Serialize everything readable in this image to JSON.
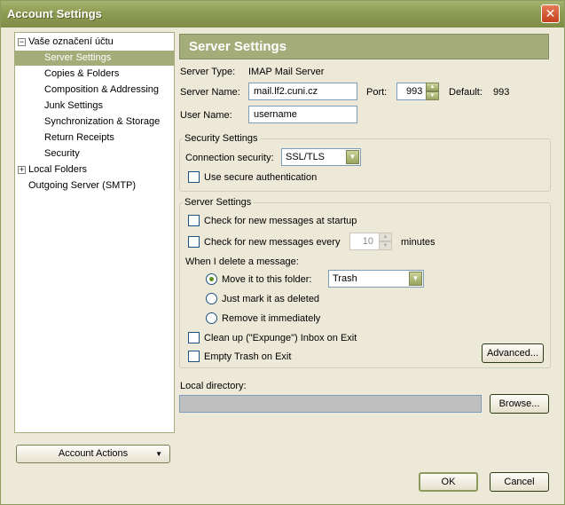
{
  "window": {
    "title": "Account Settings",
    "close_glyph": "✕"
  },
  "tree": {
    "account_name": "Vaše označení účtu",
    "items": [
      "Server Settings",
      "Copies & Folders",
      "Composition & Addressing",
      "Junk Settings",
      "Synchronization & Storage",
      "Return Receipts",
      "Security"
    ],
    "local_folders": "Local Folders",
    "outgoing_server": "Outgoing Server (SMTP)",
    "expand_glyph_open": "−",
    "expand_glyph_closed": "+"
  },
  "account_actions": {
    "label": "Account Actions",
    "arrow": "▼"
  },
  "panel": {
    "title": "Server Settings",
    "server_type_label": "Server Type:",
    "server_type_value": "IMAP Mail Server",
    "server_name_label": "Server Name:",
    "server_name_value": "mail.lf2.cuni.cz",
    "port_label": "Port:",
    "port_value": "993",
    "default_label": "Default:",
    "default_value": "993",
    "user_name_label": "User Name:",
    "user_name_value": "username"
  },
  "security": {
    "group_title": "Security Settings",
    "connection_label": "Connection security:",
    "connection_value": "SSL/TLS",
    "secure_auth_label": "Use secure authentication",
    "secure_auth_checked": false
  },
  "server_settings": {
    "group_title": "Server Settings",
    "check_startup_label": "Check for new messages at startup",
    "check_every_label": "Check for new messages every",
    "check_every_value": "10",
    "minutes_label": "minutes",
    "delete_label": "When I delete a message:",
    "move_label": "Move it to this folder:",
    "folder_value": "Trash",
    "mark_deleted_label": "Just mark it as deleted",
    "remove_label": "Remove it immediately",
    "cleanup_label": "Clean up (\"Expunge\") Inbox on Exit",
    "empty_trash_label": "Empty Trash on Exit",
    "advanced_label": "Advanced..."
  },
  "local_directory": {
    "label": "Local directory:",
    "browse_label": "Browse..."
  },
  "footer": {
    "ok_label": "OK",
    "cancel_label": "Cancel"
  },
  "colors": {
    "accent": "#a4ad7a",
    "titlebar": "#8e9c53",
    "checkbox_border": "#1c5180"
  }
}
